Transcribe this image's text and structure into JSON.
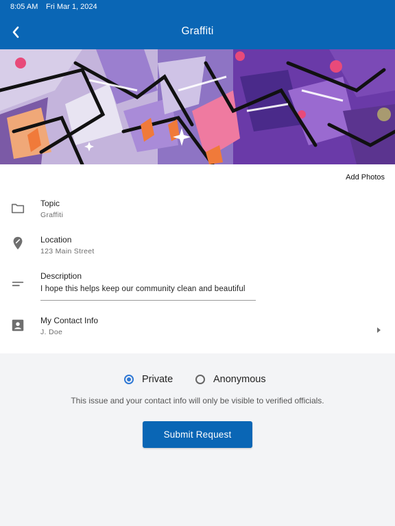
{
  "status_bar": {
    "time": "8:05 AM",
    "date": "Fri Mar 1, 2024"
  },
  "app_bar": {
    "title": "Graffiti",
    "back_icon": "chevron-left-icon"
  },
  "hero_image": {
    "subject": "graffiti-photo"
  },
  "add_photos_label": "Add Photos",
  "fields": [
    {
      "label": "Topic",
      "value": "Graffiti",
      "icon": "folder-icon"
    },
    {
      "label": "Location",
      "value": "123 Main Street",
      "icon": "location-pin-icon"
    },
    {
      "label": "Description",
      "value": "I hope this helps keep our community clean and beautiful",
      "icon": "notes-icon"
    },
    {
      "label": "My Contact Info",
      "value": "J. Doe",
      "icon": "contact-card-icon"
    }
  ],
  "privacy": {
    "options": [
      {
        "label": "Private",
        "selected": true
      },
      {
        "label": "Anonymous",
        "selected": false
      }
    ],
    "notice": "This issue and your contact info will only be visible to verified officials."
  },
  "submit_label": "Submit Request",
  "colors": {
    "primary": "#0a66b5",
    "radio_selected": "#2f78d4",
    "background": "#f3f4f6"
  }
}
